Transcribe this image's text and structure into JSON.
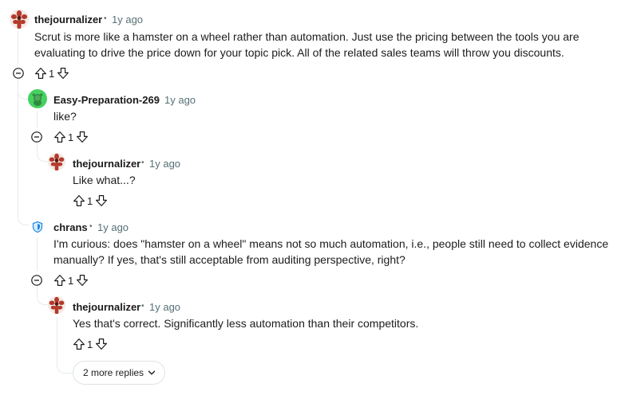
{
  "comments": [
    {
      "author": "thejournalizer",
      "sep": "•",
      "time": "1y ago",
      "lines": [
        "Scrut is more like a hamster on a wheel rather than automation. Just use the pricing between the tools you are",
        "evaluating to drive the price down for your topic pick. All of the related sales teams will throw you discounts."
      ],
      "votes": "1"
    },
    {
      "author": "Easy-Preparation-269",
      "sep": "•",
      "time": "1y ago",
      "lines": [
        "like?"
      ],
      "votes": "1"
    },
    {
      "author": "thejournalizer",
      "sep": "•",
      "time": "1y ago",
      "lines": [
        "Like what...?"
      ],
      "votes": "1"
    },
    {
      "author": "chrans",
      "sep": "•",
      "time": "1y ago",
      "lines": [
        "I'm curious: does \"hamster on a wheel\" means not so much automation, i.e., people still need to collect evidence",
        "manually? If yes, that's still acceptable from auditing perspective, right?"
      ],
      "votes": "1"
    },
    {
      "author": "thejournalizer",
      "sep": "•",
      "time": "1y ago",
      "lines": [
        "Yes that's correct. Significantly less automation than their competitors."
      ],
      "votes": "1"
    }
  ],
  "more_replies": "2 more replies",
  "icons": {
    "upvote": "upvote-icon",
    "downvote": "downvote-icon",
    "collapse": "collapse-thread-icon",
    "more": "chevron-down-icon",
    "avatar_journalizer": "demogorgon-avatar",
    "avatar_easy": "snoo-avatar",
    "avatar_chrans": "shield-avatar"
  },
  "colors": {
    "meta": "#576f76",
    "thread_line": "#e5ebee",
    "easy_avatar": "#46d160"
  }
}
